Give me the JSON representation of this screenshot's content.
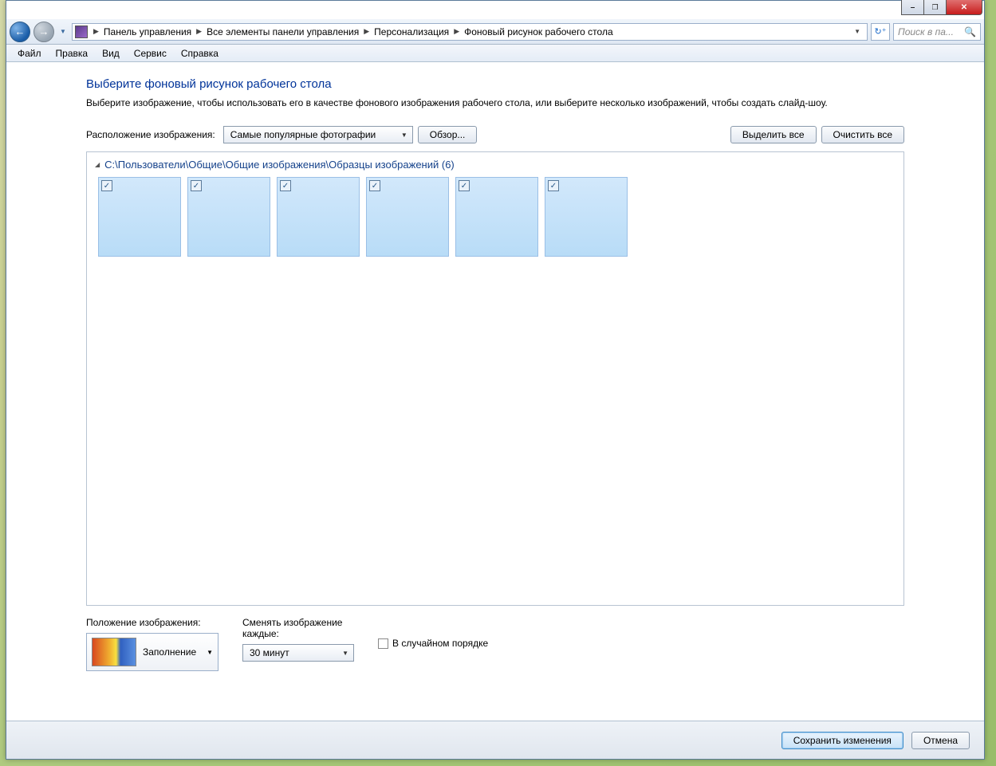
{
  "breadcrumbs": [
    "Панель управления",
    "Все элементы панели управления",
    "Персонализация",
    "Фоновый рисунок рабочего стола"
  ],
  "search": {
    "placeholder": "Поиск в па..."
  },
  "menubar": [
    "Файл",
    "Правка",
    "Вид",
    "Сервис",
    "Справка"
  ],
  "page": {
    "title": "Выберите фоновый рисунок рабочего стола",
    "subtitle": "Выберите изображение, чтобы использовать его в качестве фонового изображения рабочего стола, или выберите несколько изображений, чтобы создать слайд-шоу."
  },
  "location": {
    "label": "Расположение изображения:",
    "value": "Самые популярные фотографии",
    "browse": "Обзор...",
    "select_all": "Выделить все",
    "clear_all": "Очистить все"
  },
  "group": {
    "header": "C:\\Пользователи\\Общие\\Общие изображения\\Образцы изображений (6)",
    "count": 6
  },
  "position": {
    "label": "Положение изображения:",
    "value": "Заполнение"
  },
  "interval": {
    "label": "Сменять изображение каждые:",
    "value": "30 минут"
  },
  "shuffle": {
    "label": "В случайном порядке",
    "checked": false
  },
  "footer": {
    "save": "Сохранить изменения",
    "cancel": "Отмена"
  }
}
